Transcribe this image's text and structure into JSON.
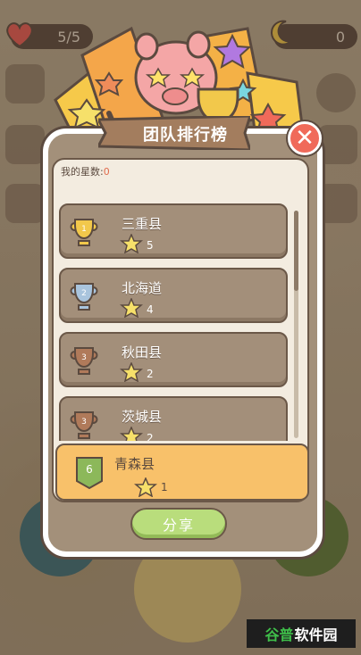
{
  "hud": {
    "hearts": "5/5",
    "coins": "0"
  },
  "modal": {
    "title": "团队排行榜",
    "my_stars_label": "我的星数:",
    "my_stars_value": "0",
    "close_symbol": "✕"
  },
  "rankings": [
    {
      "rank": "1",
      "name": "三重县",
      "stars": "5",
      "medal": "gold"
    },
    {
      "rank": "2",
      "name": "北海道",
      "stars": "4",
      "medal": "silver"
    },
    {
      "rank": "3",
      "name": "秋田县",
      "stars": "2",
      "medal": "bronze"
    },
    {
      "rank": "3",
      "name": "茨城县",
      "stars": "2",
      "medal": "bronze"
    }
  ],
  "my_team": {
    "rank": "6",
    "name": "青森县",
    "stars": "1"
  },
  "share_label": "分享",
  "watermark": {
    "accent": "谷普",
    "rest": "软件园"
  },
  "colors": {
    "gold": "#f2c84b",
    "silver": "#a9c4dd",
    "bronze": "#b07a5a",
    "row": "#a38f7a",
    "my_row": "#f8c16a",
    "share": "#b9dd7c",
    "close": "#f06a5a"
  },
  "icons": [
    "heart-icon",
    "moon-icon",
    "shop-icon",
    "gear-icon",
    "trophy-icon",
    "calendar-icon",
    "star-icon",
    "pig-mascot-icon",
    "close-icon"
  ]
}
